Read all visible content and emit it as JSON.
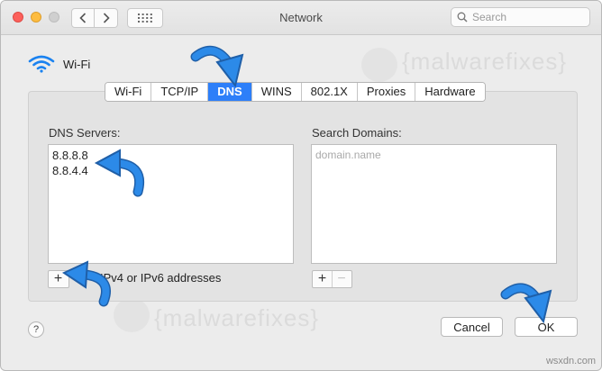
{
  "window": {
    "title": "Network"
  },
  "toolbar": {
    "search_placeholder": "Search"
  },
  "interface": {
    "name": "Wi-Fi"
  },
  "tabs": [
    {
      "label": "Wi-Fi"
    },
    {
      "label": "TCP/IP"
    },
    {
      "label": "DNS",
      "active": true
    },
    {
      "label": "WINS"
    },
    {
      "label": "802.1X"
    },
    {
      "label": "Proxies"
    },
    {
      "label": "Hardware"
    }
  ],
  "dns": {
    "label": "DNS Servers:",
    "servers": [
      "8.8.8.8",
      "8.8.4.4"
    ],
    "hint": "IPv4 or IPv6 addresses",
    "add_label": "+"
  },
  "search_domains": {
    "label": "Search Domains:",
    "placeholder": "domain.name",
    "add_label": "+",
    "remove_label": "−"
  },
  "footer": {
    "help_label": "?",
    "cancel_label": "Cancel",
    "ok_label": "OK"
  },
  "watermark": {
    "text": "{malwarefixes}"
  },
  "credit": "wsxdn.com",
  "colors": {
    "accent": "#2d7ff9",
    "arrow": "#2c8ae8"
  }
}
